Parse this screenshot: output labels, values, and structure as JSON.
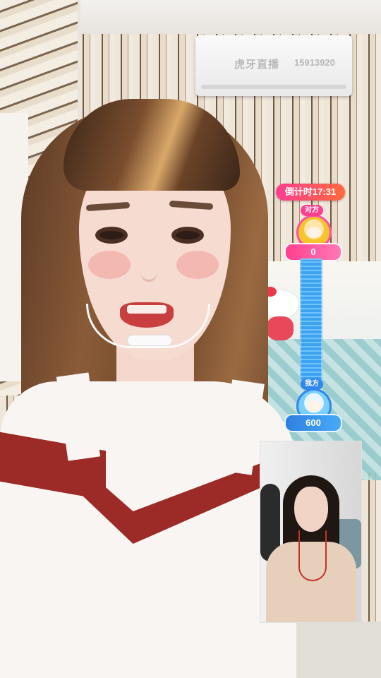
{
  "stream": {
    "watermark_brand": "虎牙直播",
    "watermark_id": "15913920"
  },
  "pk": {
    "countdown": "倒计时17:31",
    "opponent": {
      "tag": "对方",
      "score": "0",
      "accent": "#ff3f8e"
    },
    "own": {
      "tag": "我方",
      "score": "600",
      "accent": "#2f88ea"
    },
    "own_share": 1.0
  },
  "icons": {
    "opponent_avatar": "cartoon-avatar-icon",
    "own_avatar": "cartoon-avatar-icon"
  }
}
